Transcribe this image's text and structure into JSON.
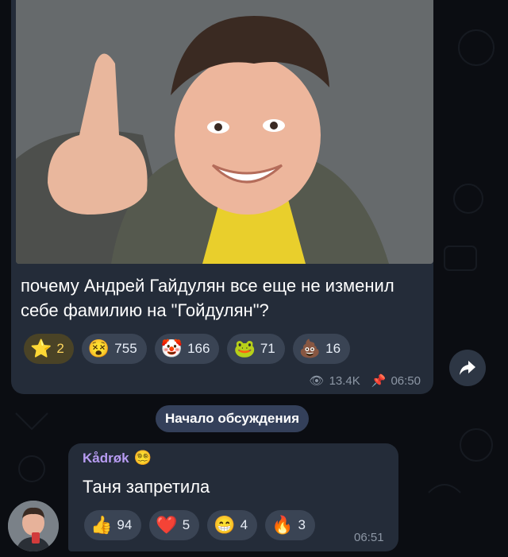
{
  "post": {
    "caption": "почему Андрей Гайдулян все еще не изменил себе фамилию на \"Гойдулян\"?",
    "reactions": [
      {
        "icon": "star-icon",
        "emoji": "⭐",
        "count": "2"
      },
      {
        "icon": "meme-face-icon",
        "emoji": "😵",
        "count": "755"
      },
      {
        "icon": "clown-icon",
        "emoji": "🤡",
        "count": "166"
      },
      {
        "icon": "pepe-icon",
        "emoji": "🐸",
        "count": "71"
      },
      {
        "icon": "poop-icon",
        "emoji": "💩",
        "count": "16"
      }
    ],
    "views": "13.4K",
    "time": "06:50"
  },
  "discussion_label": "Начало обсуждения",
  "comment": {
    "author": "Kådrøk",
    "text": "Таня запретила",
    "reactions": [
      {
        "icon": "thumbs-up-icon",
        "emoji": "👍",
        "count": "94"
      },
      {
        "icon": "heart-icon",
        "emoji": "❤️",
        "count": "5"
      },
      {
        "icon": "grin-icon",
        "emoji": "😁",
        "count": "4"
      },
      {
        "icon": "fire-icon",
        "emoji": "🔥",
        "count": "3"
      }
    ],
    "time": "06:51"
  },
  "colors": {
    "background": "#0b0d12",
    "bubble": "#242c39",
    "reaction": "#3a4454",
    "author": "#b79cf2",
    "meta": "#8d97a5"
  }
}
